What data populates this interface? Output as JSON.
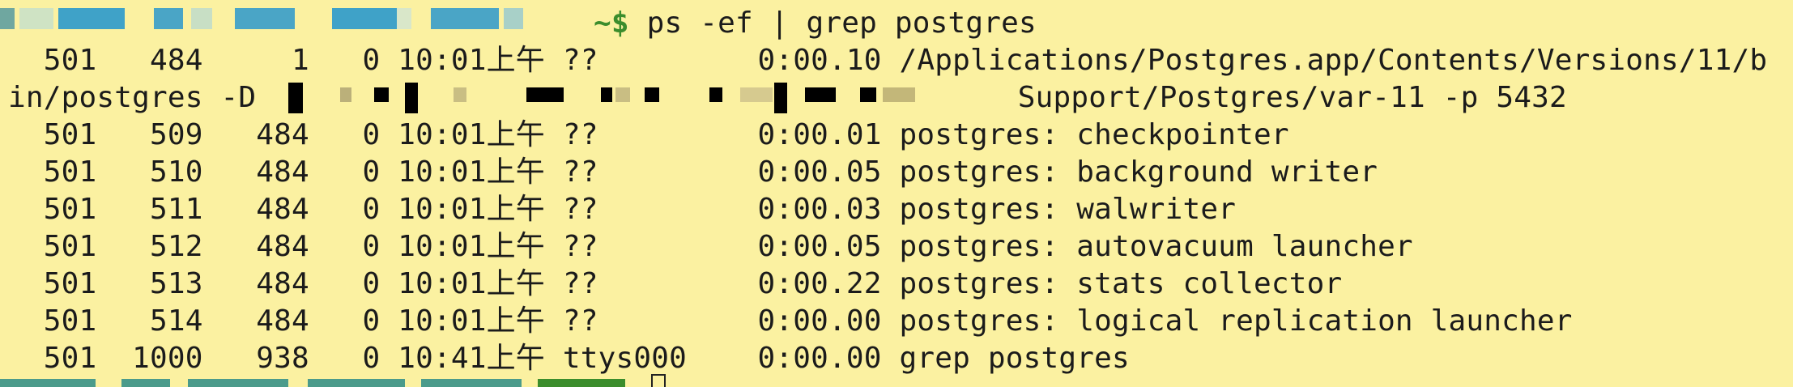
{
  "prompt": {
    "tilde": "~$",
    "command": " ps -ef | grep postgres"
  },
  "lines": [
    "  501   484     1   0 10:01上午 ??         0:00.10 /Applications/Postgres.app/Contents/Versions/11/b",
    "in/postgres -D                                           Support/Postgres/var-11 -p 5432",
    "  501   509   484   0 10:01上午 ??         0:00.01 postgres: checkpointer",
    "  501   510   484   0 10:01上午 ??         0:00.05 postgres: background writer",
    "  501   511   484   0 10:01上午 ??         0:00.03 postgres: walwriter",
    "  501   512   484   0 10:01上午 ??         0:00.05 postgres: autovacuum launcher",
    "  501   513   484   0 10:01上午 ??         0:00.22 postgres: stats collector",
    "  501   514   484   0 10:01上午 ??         0:00.00 postgres: logical replication launcher",
    "  501  1000   938   0 10:41上午 ttys000    0:00.00 grep postgres"
  ],
  "colors": {
    "background": "#fbf1a1",
    "text": "#1b1b1b",
    "prompt_green": "#3b8d2c",
    "redaction": "#000000"
  }
}
